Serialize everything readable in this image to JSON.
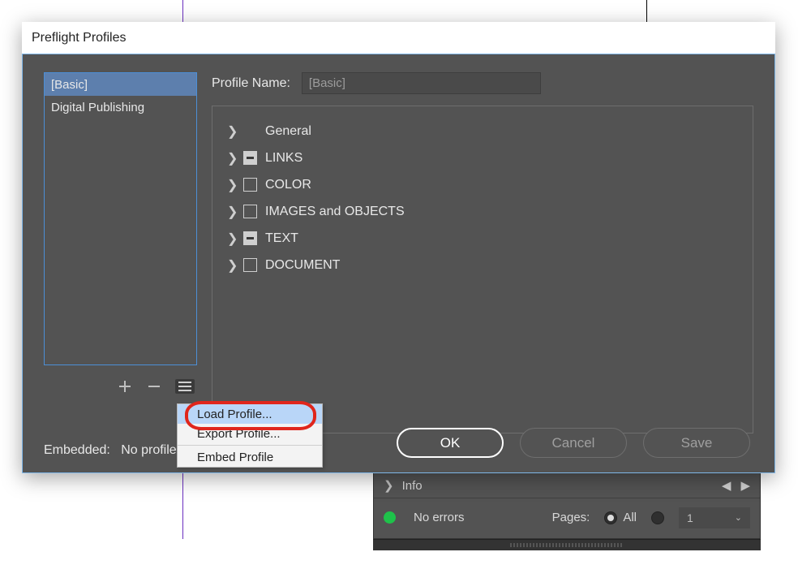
{
  "dialog": {
    "title": "Preflight Profiles",
    "name_label": "Profile Name:",
    "name_value": "[Basic]",
    "embedded_label": "Embedded:",
    "embedded_value": "No profile embedded.",
    "ok": "OK",
    "cancel": "Cancel",
    "save": "Save"
  },
  "profiles": {
    "items": [
      {
        "label": "[Basic]",
        "selected": true
      },
      {
        "label": "Digital Publishing",
        "selected": false
      }
    ]
  },
  "categories": [
    {
      "label": "General",
      "checkbox": "none"
    },
    {
      "label": "LINKS",
      "checkbox": "mixed"
    },
    {
      "label": "COLOR",
      "checkbox": "off"
    },
    {
      "label": "IMAGES and OBJECTS",
      "checkbox": "off"
    },
    {
      "label": "TEXT",
      "checkbox": "mixed"
    },
    {
      "label": "DOCUMENT",
      "checkbox": "off"
    }
  ],
  "flyout": {
    "items": [
      {
        "label": "Load Profile...",
        "hover": true
      },
      {
        "label": "Export Profile...",
        "hover": false
      },
      {
        "label": "Embed Profile",
        "hover": false
      }
    ]
  },
  "panel": {
    "info_label": "Info",
    "status_text": "No errors",
    "pages_label": "Pages:",
    "all_label": "All",
    "page_value": "1"
  }
}
